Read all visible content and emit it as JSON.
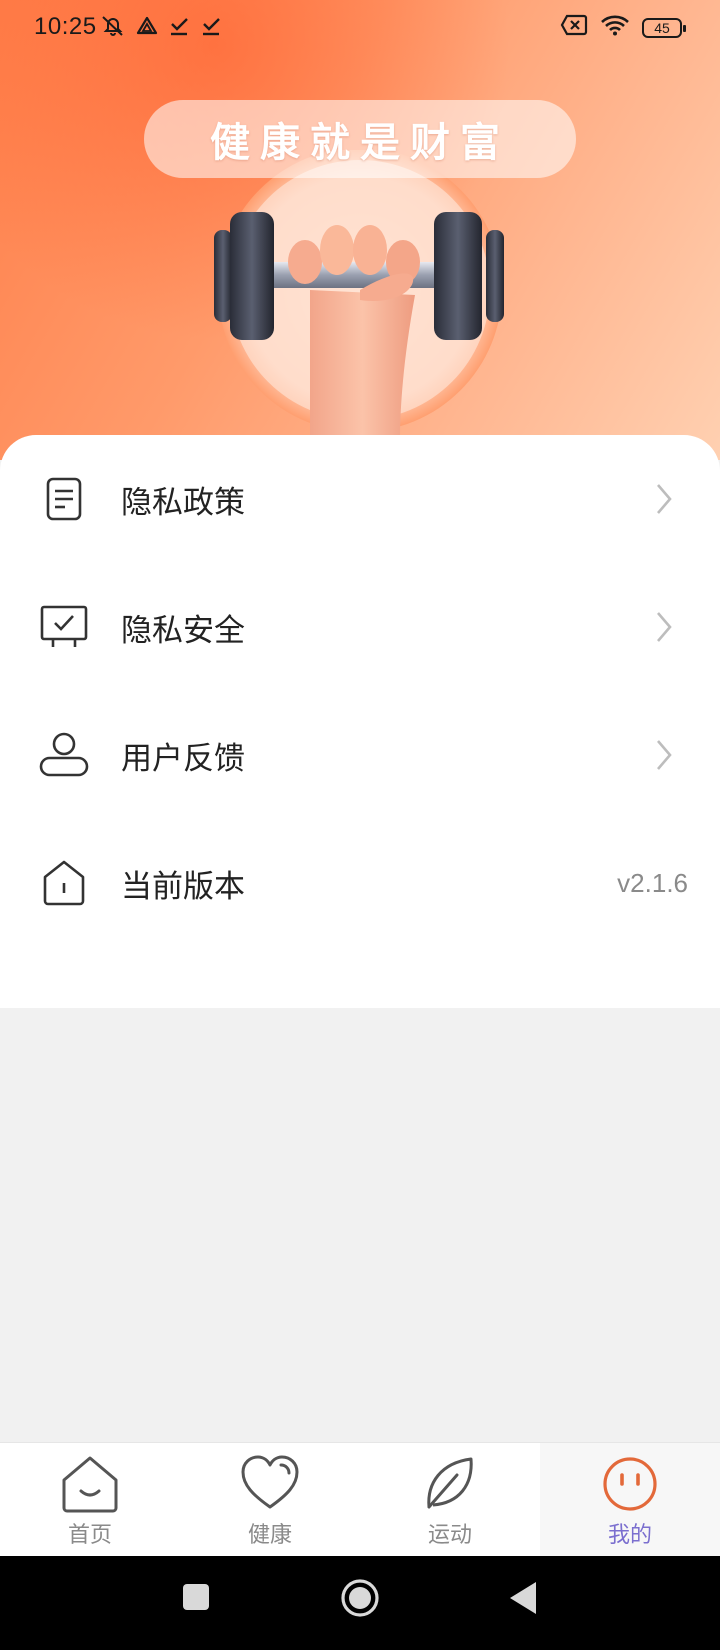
{
  "status_bar": {
    "time": "10:25",
    "battery": "45"
  },
  "hero": {
    "slogan": "健康就是财富"
  },
  "menu": {
    "items": [
      {
        "label": "隐私政策",
        "icon": "document-icon",
        "has_chevron": true
      },
      {
        "label": "隐私安全",
        "icon": "monitor-check-icon",
        "has_chevron": true
      },
      {
        "label": "用户反馈",
        "icon": "user-icon",
        "has_chevron": true
      },
      {
        "label": "当前版本",
        "icon": "house-info-icon",
        "value": "v2.1.6"
      }
    ]
  },
  "tab_bar": {
    "tabs": [
      {
        "label": "首页",
        "icon": "home-icon",
        "active": false
      },
      {
        "label": "健康",
        "icon": "heart-icon",
        "active": false
      },
      {
        "label": "运动",
        "icon": "leaf-icon",
        "active": false
      },
      {
        "label": "我的",
        "icon": "smiley-icon",
        "active": true
      }
    ]
  },
  "colors": {
    "accent_orange": "#e3693a",
    "active_tab_text": "#7b6fcf",
    "hero_gradient_start": "#ff7f4a",
    "hero_gradient_end": "#ffd0b1"
  }
}
